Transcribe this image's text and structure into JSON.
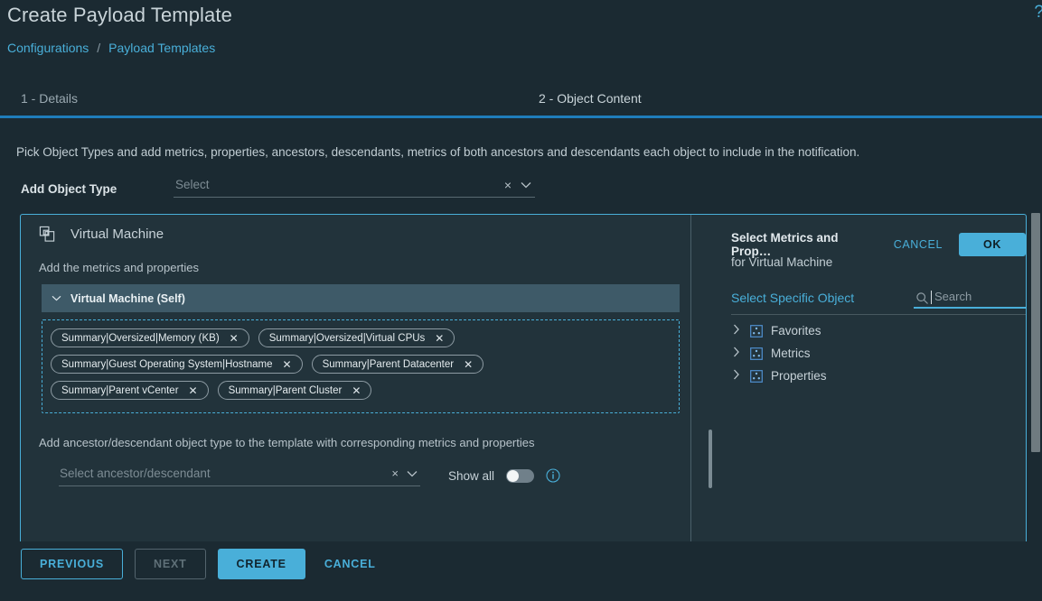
{
  "header": {
    "title": "Create Payload Template",
    "help_icon": "question-mark-icon"
  },
  "breadcrumb": {
    "items": [
      {
        "label": "Configurations"
      },
      {
        "label": "Payload Templates"
      }
    ],
    "separator": "/"
  },
  "wizard": {
    "tabs": [
      {
        "label": "1 - Details",
        "active": false
      },
      {
        "label": "2 - Object Content",
        "active": true
      }
    ],
    "accent_color": "#1f7dbb"
  },
  "main": {
    "instruction": "Pick Object Types and add metrics, properties, ancestors, descendants, metrics of both ancestors and descendants each object to include in the notification.",
    "add_object_type": {
      "label": "Add Object Type",
      "placeholder": "Select",
      "value": "",
      "clear_icon": "×",
      "caret_icon": "⌄"
    }
  },
  "object_panel": {
    "icon": "virtual-machine-icon",
    "title": "Virtual Machine",
    "sub_label": "Add the metrics and properties",
    "self_section": {
      "label": "Virtual Machine (Self)",
      "expanded": true,
      "chevron": "⌄"
    },
    "chips": [
      [
        {
          "label": "Summary|Oversized|Memory (KB)"
        },
        {
          "label": "Summary|Oversized|Virtual CPUs"
        }
      ],
      [
        {
          "label": "Summary|Guest Operating System|Hostname"
        },
        {
          "label": "Summary|Parent Datacenter"
        }
      ],
      [
        {
          "label": "Summary|Parent vCenter"
        },
        {
          "label": "Summary|Parent Cluster"
        }
      ]
    ],
    "chip_remove_icon": "✕",
    "ancestor": {
      "label": "Add ancestor/descendant object type to the template with corresponding metrics and properties",
      "placeholder": "Select ancestor/descendant",
      "value": "",
      "clear_icon": "×",
      "caret_icon": "⌄"
    },
    "show_all": {
      "label": "Show all",
      "enabled": false,
      "info_icon": "info-circle-icon"
    }
  },
  "select_panel": {
    "title": "Select Metrics and Prop…",
    "cancel_label": "CANCEL",
    "ok_label": "OK",
    "subtitle": "for Virtual Machine",
    "specific_object_link": "Select Specific Object",
    "search": {
      "placeholder": "Search",
      "value": "",
      "icon": "search-icon"
    },
    "tree": [
      {
        "label": "Favorites",
        "icon": "metric-group-icon",
        "chevron": "›",
        "expanded": false
      },
      {
        "label": "Metrics",
        "icon": "metric-group-icon",
        "chevron": "›",
        "expanded": false
      },
      {
        "label": "Properties",
        "icon": "metric-group-icon",
        "chevron": "›",
        "expanded": false
      }
    ],
    "accent_color": "#49afd9"
  },
  "footer": {
    "previous_label": "PREVIOUS",
    "next_label": "NEXT",
    "create_label": "CREATE",
    "cancel_label": "CANCEL"
  }
}
